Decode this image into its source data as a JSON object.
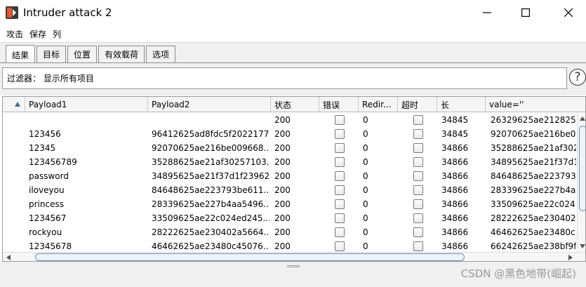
{
  "window": {
    "title": "Intruder attack 2",
    "accent_color": "#e8572a"
  },
  "menu": [
    "攻击",
    "保存",
    "列"
  ],
  "tabs": [
    {
      "label": "结果",
      "active": true
    },
    {
      "label": "目标",
      "active": false
    },
    {
      "label": "位置",
      "active": false
    },
    {
      "label": "有效载荷",
      "active": false
    },
    {
      "label": "选项",
      "active": false
    }
  ],
  "filter": {
    "text": "过滤器： 显示所有项目",
    "help_label": "?"
  },
  "table": {
    "columns": [
      "",
      "Payload1",
      "Payload2",
      "状态",
      "错误",
      "Redir...",
      "超时",
      "长",
      "value=''"
    ],
    "sort_column": 0,
    "rows": [
      {
        "p1": "",
        "p2": "",
        "status": "200",
        "redir": "0",
        "length": "34845",
        "value": "26329625ae212825..."
      },
      {
        "p1": "123456",
        "p2": "96412625ad8fdc5f2022177...",
        "status": "200",
        "redir": "0",
        "length": "34845",
        "value": "92070625ae216be0..."
      },
      {
        "p1": "12345",
        "p2": "92070625ae216be009668...",
        "status": "200",
        "redir": "0",
        "length": "34866",
        "value": "35288625ae21af302..."
      },
      {
        "p1": "123456789",
        "p2": "35288625ae21af30257103...",
        "status": "200",
        "redir": "0",
        "length": "34866",
        "value": "34895625ae21f37d1f..."
      },
      {
        "p1": "password",
        "p2": "34895625ae21f37d1f23962...",
        "status": "200",
        "redir": "0",
        "length": "34866",
        "value": "84648625ae223793..."
      },
      {
        "p1": "iloveyou",
        "p2": "84648625ae223793be611...",
        "status": "200",
        "redir": "0",
        "length": "34866",
        "value": "28339625ae227b4a..."
      },
      {
        "p1": "princess",
        "p2": "28339625ae227b4aa5496...",
        "status": "200",
        "redir": "0",
        "length": "34866",
        "value": "33509625ae22c024..."
      },
      {
        "p1": "1234567",
        "p2": "33509625ae22c024ed245...",
        "status": "200",
        "redir": "0",
        "length": "34866",
        "value": "28222625ae230402..."
      },
      {
        "p1": "rockyou",
        "p2": "28222625ae230402a5664...",
        "status": "200",
        "redir": "0",
        "length": "34866",
        "value": "46462625ae23480c..."
      },
      {
        "p1": "12345678",
        "p2": "46462625ae23480c45076...",
        "status": "200",
        "redir": "0",
        "length": "34866",
        "value": "66242625ae238bf9f7..."
      }
    ]
  },
  "watermark": "CSDN @黑色地带(崛起)"
}
